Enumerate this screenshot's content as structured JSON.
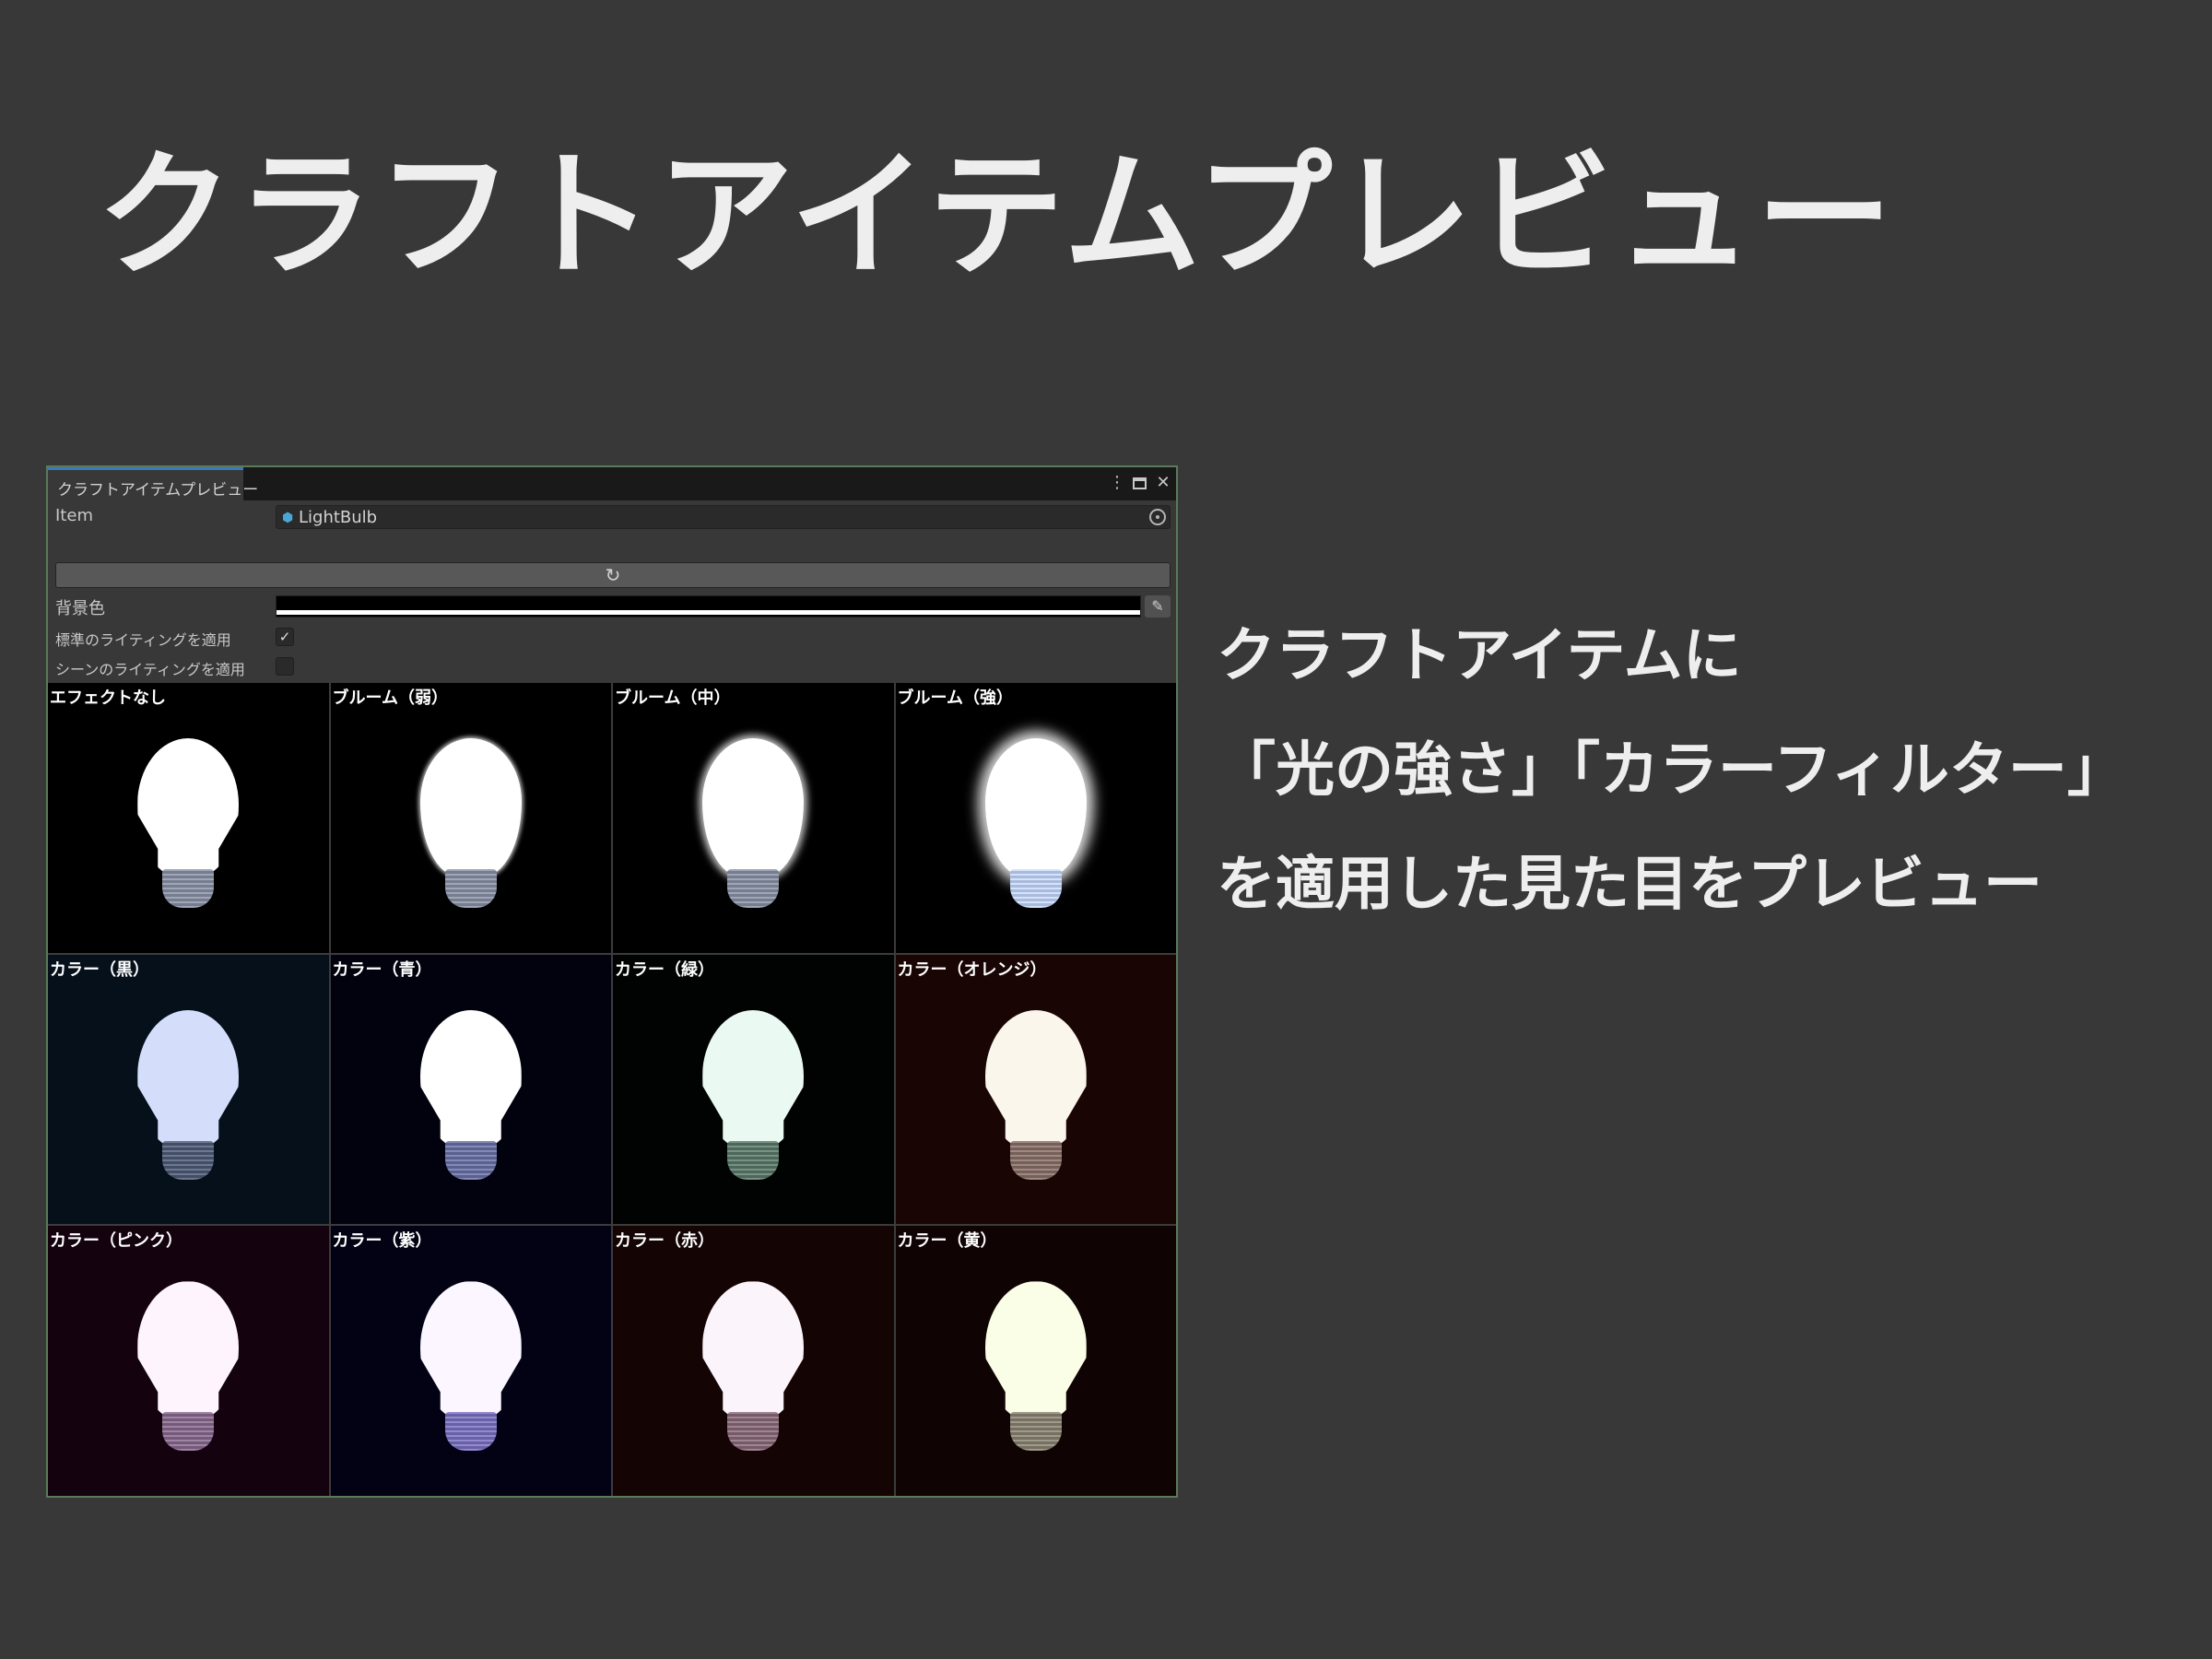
{
  "slide": {
    "title": "クラフトアイテムプレビュー",
    "description": [
      "クラフトアイテムに",
      "「光の強さ」「カラーフィルター」",
      "を適用した見た目をプレビュー"
    ]
  },
  "window": {
    "tab_title": "クラフトアイテムプレビュー",
    "controls": {
      "menu_icon": "kebab-menu-icon",
      "maximize_icon": "maximize-icon",
      "close_icon": "close-icon",
      "menu_glyph": "⋮",
      "close_glyph": "✕"
    },
    "fields": {
      "item_label": "Item",
      "item_value": "LightBulb",
      "item_icon": "prefab-cube-icon",
      "refresh_icon": "refresh-icon",
      "refresh_glyph": "↻",
      "bg_color_label": "背景色",
      "bg_color_value": "#000000",
      "eyedropper_icon": "eyedropper-icon",
      "std_lighting_label": "標準のライティングを適用",
      "std_lighting_checked": true,
      "scene_lighting_label": "シーンのライティングを適用",
      "scene_lighting_checked": false
    }
  },
  "previews": [
    {
      "label": "エフェクトなし",
      "bg": "#000000",
      "glass": "#ffffff",
      "base": "#8a93a8",
      "glow": "none"
    },
    {
      "label": "ブルーム（弱）",
      "bg": "#000000",
      "glass": "#ffffff",
      "base": "#8a93a8",
      "glow": "weak"
    },
    {
      "label": "ブルーム（中）",
      "bg": "#000000",
      "glass": "#ffffff",
      "base": "#8a93a8",
      "glow": "medium"
    },
    {
      "label": "ブルーム（強）",
      "bg": "#000000",
      "glass": "#ffffff",
      "base": "#c8dcff",
      "glow": "strong"
    },
    {
      "label": "カラー（黒）",
      "bg": "#06101a",
      "glass": "#d4defa",
      "base": "#4e5a78",
      "glow": "none"
    },
    {
      "label": "カラー（青）",
      "bg": "#02020e",
      "glass": "#ffffff",
      "base": "#6a72a8",
      "glow": "none"
    },
    {
      "label": "カラー（緑）",
      "bg": "#010302",
      "glass": "#eafaf2",
      "base": "#5a7a6a",
      "glow": "none"
    },
    {
      "label": "カラー（オレンジ）",
      "bg": "#1a0505",
      "glass": "#faf6ec",
      "base": "#8a7068",
      "glow": "none"
    },
    {
      "label": "カラー（ピンク）",
      "bg": "#14020f",
      "glass": "#fdf4fe",
      "base": "#8a6a90",
      "glow": "none"
    },
    {
      "label": "カラー（紫）",
      "bg": "#020214",
      "glass": "#fbf6ff",
      "base": "#7a72c4",
      "glow": "none"
    },
    {
      "label": "カラー（赤）",
      "bg": "#140404",
      "glass": "#fcf4fb",
      "base": "#8a6a7a",
      "glow": "none"
    },
    {
      "label": "カラー（黄）",
      "bg": "#100303",
      "glass": "#fafee6",
      "base": "#8a8472",
      "glow": "none"
    }
  ]
}
